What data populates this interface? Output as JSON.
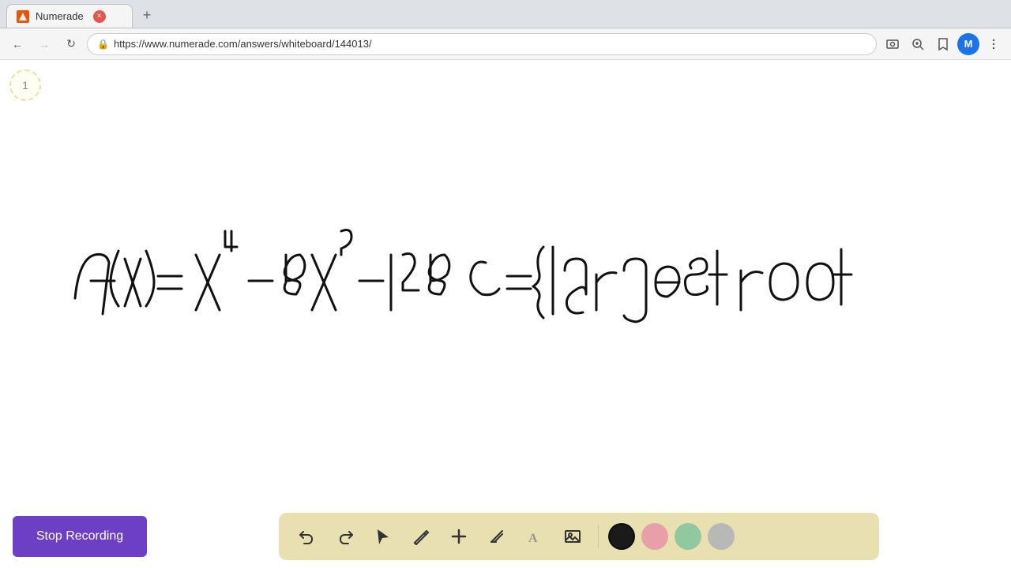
{
  "browser": {
    "tab_title": "Numerade",
    "tab_favicon": "N",
    "url": "https://www.numerade.com/answers/whiteboard/144013/",
    "new_tab_label": "+",
    "nav_back": "←",
    "nav_forward": "→",
    "nav_reload": "↻",
    "profile_initial": "M"
  },
  "page_indicator": {
    "number": "1"
  },
  "toolbar": {
    "undo_label": "undo",
    "redo_label": "redo",
    "select_label": "select",
    "pen_label": "pen",
    "add_label": "add",
    "eraser_label": "eraser",
    "text_label": "text",
    "image_label": "image",
    "colors": [
      {
        "name": "black",
        "hex": "#1a1a1a"
      },
      {
        "name": "pink",
        "hex": "#e8a0a8"
      },
      {
        "name": "green",
        "hex": "#90c8a0"
      },
      {
        "name": "gray",
        "hex": "#b8b8b8"
      }
    ]
  },
  "stop_recording": {
    "label": "Stop Recording",
    "bg_color": "#6c3fc4"
  },
  "math_expression": "f(x)= x⁴ - 8x² - 128   c= { largest root"
}
